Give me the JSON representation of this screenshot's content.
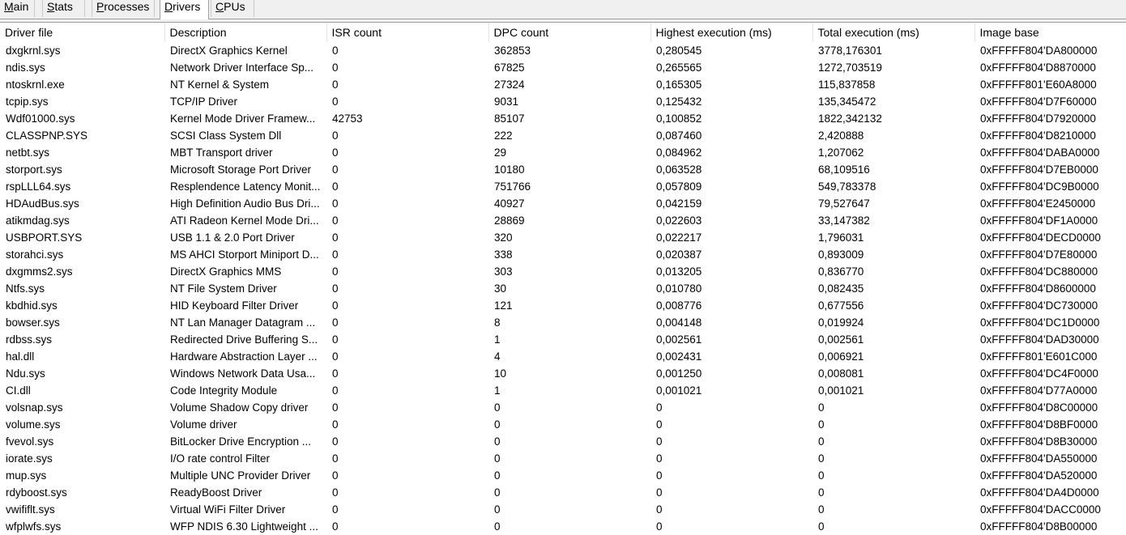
{
  "tabs": [
    {
      "label": "Main",
      "underline": "M",
      "rest": "ain"
    },
    {
      "label": "Stats",
      "underline": "S",
      "rest": "tats"
    },
    {
      "label": "Processes",
      "underline": "P",
      "rest": "rocesses"
    },
    {
      "label": "Drivers",
      "underline": "D",
      "rest": "rivers",
      "active": true
    },
    {
      "label": "CPUs",
      "underline": "C",
      "rest": "PUs"
    }
  ],
  "columns": [
    "Driver file",
    "Description",
    "ISR count",
    "DPC count",
    "Highest execution (ms)",
    "Total execution (ms)",
    "Image base"
  ],
  "rows": [
    [
      "dxgkrnl.sys",
      "DirectX Graphics Kernel",
      "0",
      "362853",
      "0,280545",
      "3778,176301",
      "0xFFFFF804'DA800000"
    ],
    [
      "ndis.sys",
      "Network Driver Interface Sp...",
      "0",
      "67825",
      "0,265565",
      "1272,703519",
      "0xFFFFF804'D8870000"
    ],
    [
      "ntoskrnl.exe",
      "NT Kernel & System",
      "0",
      "27324",
      "0,165305",
      "115,837858",
      "0xFFFFF801'E60A8000"
    ],
    [
      "tcpip.sys",
      "TCP/IP Driver",
      "0",
      "9031",
      "0,125432",
      "135,345472",
      "0xFFFFF804'D7F60000"
    ],
    [
      "Wdf01000.sys",
      "Kernel Mode Driver Framew...",
      "42753",
      "85107",
      "0,100852",
      "1822,342132",
      "0xFFFFF804'D7920000"
    ],
    [
      "CLASSPNP.SYS",
      "SCSI Class System Dll",
      "0",
      "222",
      "0,087460",
      "2,420888",
      "0xFFFFF804'D8210000"
    ],
    [
      "netbt.sys",
      "MBT Transport driver",
      "0",
      "29",
      "0,084962",
      "1,207062",
      "0xFFFFF804'DABA0000"
    ],
    [
      "storport.sys",
      "Microsoft Storage Port Driver",
      "0",
      "10180",
      "0,063528",
      "68,109516",
      "0xFFFFF804'D7EB0000"
    ],
    [
      "rspLLL64.sys",
      "Resplendence Latency Monit...",
      "0",
      "751766",
      "0,057809",
      "549,783378",
      "0xFFFFF804'DC9B0000"
    ],
    [
      "HDAudBus.sys",
      "High Definition Audio Bus Dri...",
      "0",
      "40927",
      "0,042159",
      "79,527647",
      "0xFFFFF804'E2450000"
    ],
    [
      "atikmdag.sys",
      "ATI Radeon Kernel Mode Dri...",
      "0",
      "28869",
      "0,022603",
      "33,147382",
      "0xFFFFF804'DF1A0000"
    ],
    [
      "USBPORT.SYS",
      "USB 1.1 & 2.0 Port Driver",
      "0",
      "320",
      "0,022217",
      "1,796031",
      "0xFFFFF804'DECD0000"
    ],
    [
      "storahci.sys",
      "MS AHCI Storport Miniport D...",
      "0",
      "338",
      "0,020387",
      "0,893009",
      "0xFFFFF804'D7E80000"
    ],
    [
      "dxgmms2.sys",
      "DirectX Graphics MMS",
      "0",
      "303",
      "0,013205",
      "0,836770",
      "0xFFFFF804'DC880000"
    ],
    [
      "Ntfs.sys",
      "NT File System Driver",
      "0",
      "30",
      "0,010780",
      "0,082435",
      "0xFFFFF804'D8600000"
    ],
    [
      "kbdhid.sys",
      "HID Keyboard Filter Driver",
      "0",
      "121",
      "0,008776",
      "0,677556",
      "0xFFFFF804'DC730000"
    ],
    [
      "bowser.sys",
      "NT Lan Manager Datagram ...",
      "0",
      "8",
      "0,004148",
      "0,019924",
      "0xFFFFF804'DC1D0000"
    ],
    [
      "rdbss.sys",
      "Redirected Drive Buffering S...",
      "0",
      "1",
      "0,002561",
      "0,002561",
      "0xFFFFF804'DAD30000"
    ],
    [
      "hal.dll",
      "Hardware Abstraction Layer ...",
      "0",
      "4",
      "0,002431",
      "0,006921",
      "0xFFFFF801'E601C000"
    ],
    [
      "Ndu.sys",
      "Windows Network Data Usa...",
      "0",
      "10",
      "0,001250",
      "0,008081",
      "0xFFFFF804'DC4F0000"
    ],
    [
      "CI.dll",
      "Code Integrity Module",
      "0",
      "1",
      "0,001021",
      "0,001021",
      "0xFFFFF804'D77A0000"
    ],
    [
      "volsnap.sys",
      "Volume Shadow Copy driver",
      "0",
      "0",
      "0",
      "0",
      "0xFFFFF804'D8C00000"
    ],
    [
      "volume.sys",
      "Volume driver",
      "0",
      "0",
      "0",
      "0",
      "0xFFFFF804'D8BF0000"
    ],
    [
      "fvevol.sys",
      "BitLocker Drive Encryption ...",
      "0",
      "0",
      "0",
      "0",
      "0xFFFFF804'D8B30000"
    ],
    [
      "iorate.sys",
      "I/O rate control Filter",
      "0",
      "0",
      "0",
      "0",
      "0xFFFFF804'DA550000"
    ],
    [
      "mup.sys",
      "Multiple UNC Provider Driver",
      "0",
      "0",
      "0",
      "0",
      "0xFFFFF804'DA520000"
    ],
    [
      "rdyboost.sys",
      "ReadyBoost Driver",
      "0",
      "0",
      "0",
      "0",
      "0xFFFFF804'DA4D0000"
    ],
    [
      "vwififlt.sys",
      "Virtual WiFi Filter Driver",
      "0",
      "0",
      "0",
      "0",
      "0xFFFFF804'DACC0000"
    ],
    [
      "wfplwfs.sys",
      "WFP NDIS 6.30 Lightweight ...",
      "0",
      "0",
      "0",
      "0",
      "0xFFFFF804'D8B00000"
    ]
  ]
}
